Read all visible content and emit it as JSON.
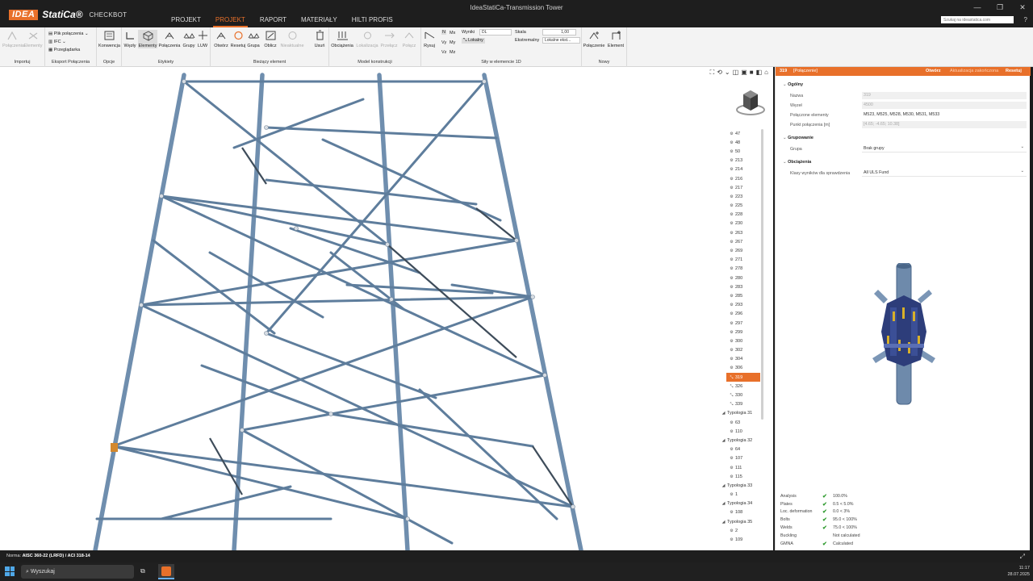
{
  "titlebar": {
    "logo_mark": "IDEA",
    "logo_name": "StatiCa®",
    "product": "CHECKBOT",
    "window_title": "IdeaStatiCa-Transmission Tower",
    "web_search_placeholder": "Szukaj na ideastatica.com",
    "menu": [
      "PROJEKT",
      "PROJEKT",
      "RAPORT",
      "MATERIAŁY",
      "HILTI PROFIS"
    ],
    "active_menu_index": 1
  },
  "ribbon": {
    "groups": {
      "importuj": {
        "label": "Importuj",
        "buttons": [
          "Połączenia",
          "Elementy"
        ]
      },
      "eksport": {
        "label": "Eksport Połączenia",
        "items": [
          "Plik połączenia",
          "IFC",
          "Przeglądarka"
        ]
      },
      "opcje": {
        "label": "Opcje",
        "buttons": [
          "Konwencja"
        ]
      },
      "etykiety": {
        "label": "Etykiety",
        "buttons": [
          "Węzły",
          "Elementy",
          "Połączenia",
          "Grupy",
          "LUW"
        ]
      },
      "biezacy": {
        "label": "Bieżący element",
        "buttons": [
          "Otwórz",
          "Resetuj",
          "Grupa",
          "Oblicz",
          "Nieaktualne",
          "Usuń"
        ]
      },
      "model": {
        "label": "Model konstrukcji",
        "buttons": [
          "Obciążenia",
          "Lokalizacja",
          "Przełącz",
          "Połącz"
        ]
      },
      "sily": {
        "label": "Siły w elemencie 1D",
        "buttons": [
          "Rysuj"
        ],
        "forces": [
          "N",
          "Mx",
          "Vy",
          "My",
          "Vz",
          "Mz"
        ],
        "wyniki_label": "Wyniki",
        "wyniki_value": "DL",
        "lokalny": "Lokalny",
        "skala_label": "Skala",
        "skala_value": "1,00",
        "ekstremalny_label": "Ekstremalny",
        "ekstremalny_value": "Lokalne ekst..."
      },
      "nowy": {
        "label": "Nowy",
        "buttons": [
          "Połączenie",
          "Element"
        ]
      }
    }
  },
  "tree": {
    "items": [
      {
        "label": "47",
        "kind": "node"
      },
      {
        "label": "48",
        "kind": "node"
      },
      {
        "label": "50",
        "kind": "node"
      },
      {
        "label": "213",
        "kind": "node"
      },
      {
        "label": "214",
        "kind": "node"
      },
      {
        "label": "216",
        "kind": "node"
      },
      {
        "label": "217",
        "kind": "node"
      },
      {
        "label": "223",
        "kind": "node"
      },
      {
        "label": "225",
        "kind": "node"
      },
      {
        "label": "228",
        "kind": "node"
      },
      {
        "label": "230",
        "kind": "node"
      },
      {
        "label": "263",
        "kind": "node"
      },
      {
        "label": "267",
        "kind": "node"
      },
      {
        "label": "269",
        "kind": "node"
      },
      {
        "label": "271",
        "kind": "node"
      },
      {
        "label": "278",
        "kind": "node"
      },
      {
        "label": "280",
        "kind": "node"
      },
      {
        "label": "283",
        "kind": "node"
      },
      {
        "label": "285",
        "kind": "node"
      },
      {
        "label": "293",
        "kind": "node"
      },
      {
        "label": "296",
        "kind": "node"
      },
      {
        "label": "297",
        "kind": "node"
      },
      {
        "label": "299",
        "kind": "node"
      },
      {
        "label": "300",
        "kind": "node"
      },
      {
        "label": "302",
        "kind": "node"
      },
      {
        "label": "304",
        "kind": "node"
      },
      {
        "label": "306",
        "kind": "node"
      },
      {
        "label": "319",
        "kind": "conn",
        "selected": true
      },
      {
        "label": "326",
        "kind": "conn"
      },
      {
        "label": "330",
        "kind": "conn"
      },
      {
        "label": "339",
        "kind": "conn"
      },
      {
        "label": "Typologia 31",
        "kind": "group"
      },
      {
        "label": "63",
        "kind": "node"
      },
      {
        "label": "110",
        "kind": "node"
      },
      {
        "label": "Typologia 32",
        "kind": "group"
      },
      {
        "label": "64",
        "kind": "node"
      },
      {
        "label": "107",
        "kind": "node"
      },
      {
        "label": "111",
        "kind": "node"
      },
      {
        "label": "115",
        "kind": "node"
      },
      {
        "label": "Typologia 33",
        "kind": "group"
      },
      {
        "label": "1",
        "kind": "node"
      },
      {
        "label": "Typologia 34",
        "kind": "group"
      },
      {
        "label": "108",
        "kind": "node"
      },
      {
        "label": "Typologia 35",
        "kind": "group"
      },
      {
        "label": "2",
        "kind": "node"
      },
      {
        "label": "109",
        "kind": "node"
      }
    ]
  },
  "panel": {
    "header": {
      "id": "319",
      "type": "[Połączenie]",
      "open": "Otwórz",
      "update": "Aktualizacja zakończona",
      "reset": "Resetuj"
    },
    "sections": {
      "ogolny": "Ogólny",
      "grupowanie": "Grupowanie",
      "obciazenia": "Obciążenia"
    },
    "props": {
      "nazwa_label": "Nazwa",
      "nazwa_value": "319",
      "wezel_label": "Węzeł",
      "wezel_value": "4500",
      "polaczone_label": "Połączone elementy",
      "polaczone_value": "M523, M525, M528, M530, M531, M533",
      "punkt_label": "Punkt połączenia [m]",
      "punkt_value": "[4.65; -4.65; 10.38]",
      "grupa_label": "Grupa",
      "grupa_value": "Brak grupy",
      "klasy_label": "Klasy wyników dla sprawdzenia",
      "klasy_value": "All ULS Fund"
    },
    "results": [
      {
        "name": "Analysis",
        "check": true,
        "value": "100.0%"
      },
      {
        "name": "Plates",
        "check": true,
        "value": "0.5 < 5.0%"
      },
      {
        "name": "Loc. deformation",
        "check": true,
        "value": "0.0 < 3%"
      },
      {
        "name": "Bolts",
        "check": true,
        "value": "95.0 < 100%"
      },
      {
        "name": "Welds",
        "check": true,
        "value": "75.0 < 100%"
      },
      {
        "name": "Buckling",
        "check": false,
        "value": "Not calculated"
      },
      {
        "name": "GMNA",
        "check": true,
        "value": "Calculated"
      }
    ]
  },
  "statusbar": {
    "norm_label": "Norma:",
    "norm_value": "AISC 360-22 (LRFD) / ACI 318-14"
  },
  "taskbar": {
    "search": "Wyszukaj",
    "time": "11:17",
    "date": "28.07.2025"
  }
}
